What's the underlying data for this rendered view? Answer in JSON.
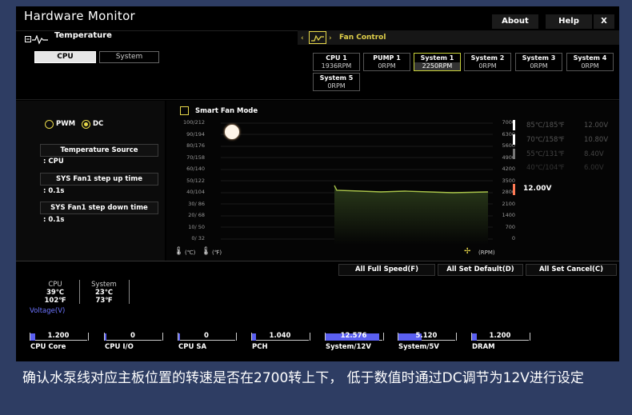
{
  "window": {
    "title": "Hardware Monitor",
    "about": "About",
    "help": "Help",
    "close": "X"
  },
  "temperature": {
    "header": "Temperature",
    "tabs": [
      "CPU",
      "System"
    ],
    "mode_pwm": "PWM",
    "mode_dc": "DC",
    "selected_mode": "DC",
    "source_label": "Temperature Source",
    "source_value": ": CPU",
    "step_up_label": "SYS Fan1 step up time",
    "step_up_value": ": 0.1s",
    "step_down_label": "SYS Fan1 step down time",
    "step_down_value": ": 0.1s"
  },
  "fan_control": {
    "header": "Fan Control",
    "fans": [
      {
        "name": "CPU 1",
        "rpm": "1936RPM"
      },
      {
        "name": "PUMP 1",
        "rpm": "0RPM"
      },
      {
        "name": "System 1",
        "rpm": "2250RPM",
        "active": true
      },
      {
        "name": "System 2",
        "rpm": "0RPM"
      },
      {
        "name": "System 3",
        "rpm": "0RPM"
      },
      {
        "name": "System 4",
        "rpm": "0RPM"
      },
      {
        "name": "System 5",
        "rpm": "0RPM"
      }
    ],
    "smart_fan_mode": "Smart Fan Mode",
    "smart_fan_checked": false,
    "temp_ticks": [
      "100/212",
      "90/194",
      "80/176",
      "70/158",
      "60/140",
      "50/122",
      "40/104",
      "30/ 86",
      "20/ 68",
      "10/ 50",
      "0/ 32"
    ],
    "rpm_ticks": [
      "7000",
      "6300",
      "5600",
      "4900",
      "4200",
      "3500",
      "2800",
      "2100",
      "1400",
      "700",
      "0"
    ],
    "celsius_label": "(℃)",
    "fahrenheit_label": "(℉)",
    "rpm_label": "(RPM)",
    "legend": [
      {
        "text": "85℃/185℉",
        "value": "12.00V"
      },
      {
        "text": "70℃/158℉",
        "value": "10.80V"
      },
      {
        "text": "55℃/131℉",
        "value": "8.40V"
      },
      {
        "text": "40℃/104℉",
        "value": "6.00V"
      }
    ],
    "current_voltage": "12.00V",
    "accent": "#e8d84a"
  },
  "actions": {
    "full_speed": "All Full Speed(F)",
    "set_default": "All Set Default(D)",
    "set_cancel": "All Set Cancel(C)"
  },
  "readings": {
    "cpu_label": "CPU",
    "cpu_c": "39℃",
    "cpu_f": "102℉",
    "system_label": "System",
    "system_c": "23℃",
    "system_f": "73℉",
    "voltage_label": "Voltage(V)"
  },
  "voltages": [
    {
      "label": "CPU Core",
      "value": "1.200",
      "fill": 0.08
    },
    {
      "label": "CPU I/O",
      "value": "0",
      "fill": 0
    },
    {
      "label": "CPU SA",
      "value": "0",
      "fill": 0
    },
    {
      "label": "PCH",
      "value": "1.040",
      "fill": 0.07
    },
    {
      "label": "System/12V",
      "value": "12.576",
      "fill": 0.95
    },
    {
      "label": "System/5V",
      "value": "5.120",
      "fill": 0.42
    },
    {
      "label": "DRAM",
      "value": "1.200",
      "fill": 0.08
    }
  ],
  "caption": "确认水泵线对应主板位置的转速是否在2700转上下， 低于数值时通过DC调节为12V进行设定"
}
